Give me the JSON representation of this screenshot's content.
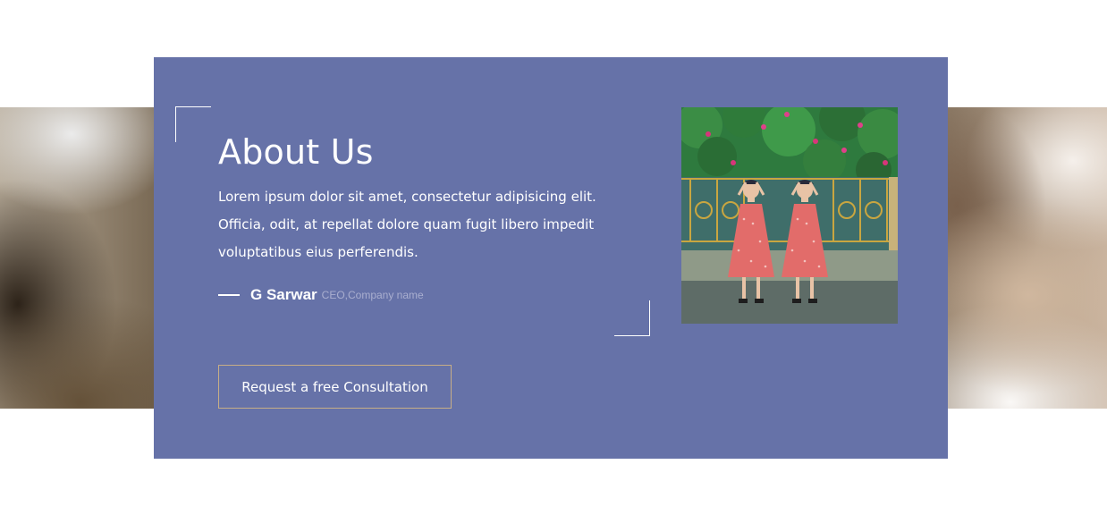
{
  "about": {
    "title": "About Us",
    "body": "Lorem ipsum dolor sit amet, consectetur adipisicing elit. Officia, odit, at repellat dolore quam fugit libero impedit voluptatibus eius perferendis.",
    "author_name": "G Sarwar",
    "author_role": "CEO,Company name",
    "cta_label": "Request a free Consultation"
  },
  "colors": {
    "card": "#6672a8",
    "cta_border": "#c7ae86",
    "role_text": "#a9aecf"
  }
}
